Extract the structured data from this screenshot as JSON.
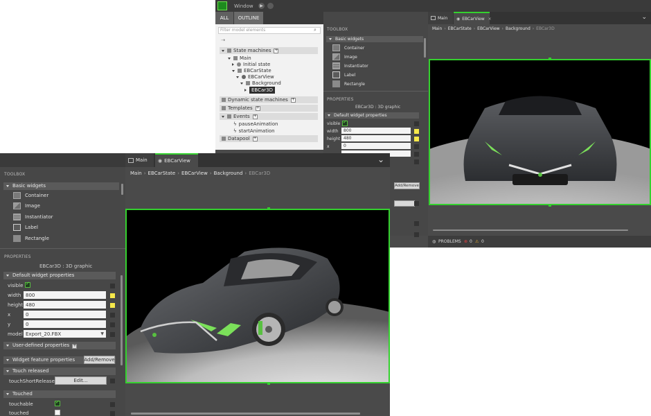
{
  "back": {
    "window_title": "Window",
    "left_tabs": [
      "ALL",
      "OUTLINE"
    ],
    "filter_placeholder": "Filter model elements",
    "tree": [
      {
        "label": "State machines",
        "plus": true
      },
      {
        "label": "Main"
      },
      {
        "label": "Initial state"
      },
      {
        "label": "EBCarState"
      },
      {
        "label": "EBCarView"
      },
      {
        "label": "Background"
      },
      {
        "label": "EBCar3D"
      },
      {
        "label": "Dynamic state machines",
        "plus": true
      },
      {
        "label": "Templates",
        "plus": true
      },
      {
        "label": "Events",
        "plus": true
      },
      {
        "label": "pauseAnimation"
      },
      {
        "label": "startAnimation"
      },
      {
        "label": "Datapool",
        "plus": true
      }
    ],
    "toolbox_title": "TOOLBOX",
    "basic_widgets": "Basic widgets",
    "widgets": [
      "Container",
      "Image",
      "Instantiator",
      "Label",
      "Rectangle"
    ],
    "properties_title": "PROPERTIES",
    "prop_subtitle": "EBCar3D : 3D graphic",
    "default_props": "Default widget properties",
    "props": [
      {
        "label": "visible",
        "value": ""
      },
      {
        "label": "width",
        "value": "800"
      },
      {
        "label": "height",
        "value": "480"
      },
      {
        "label": "x",
        "value": "0"
      }
    ],
    "add_remove": "Add/Remove",
    "tabs": [
      {
        "label": "Main"
      },
      {
        "label": "EBCarView"
      }
    ],
    "breadcrumb": [
      "Main",
      "EBCarState",
      "EBCarView",
      "Background"
    ],
    "breadcrumb_current": "EBCar3D",
    "status_problems": "PROBLEMS",
    "status_errors": "0",
    "status_warnings": "0"
  },
  "front": {
    "toolbox_title": "TOOLBOX",
    "basic_widgets": "Basic widgets",
    "widgets": [
      "Container",
      "Image",
      "Instantiator",
      "Label",
      "Rectangle"
    ],
    "properties_title": "PROPERTIES",
    "prop_subtitle": "EBCar3D : 3D graphic",
    "default_props": "Default widget properties",
    "props": [
      {
        "label": "visible",
        "value": ""
      },
      {
        "label": "width",
        "value": "800"
      },
      {
        "label": "height",
        "value": "480"
      },
      {
        "label": "x",
        "value": "0"
      },
      {
        "label": "y",
        "value": "0"
      },
      {
        "label": "model",
        "value": "Export_20.FBX"
      }
    ],
    "user_defined": "User-defined properties",
    "widget_feature": "Widget feature properties",
    "add_remove": "Add/Remove",
    "touch_released": "Touch released",
    "touch_short_released": "touchShortReleased",
    "edit_button": "Edit...",
    "touched_section": "Touched",
    "touchable": "touchable",
    "touched": "touched",
    "tabs": [
      {
        "label": "Main"
      },
      {
        "label": "EBCarView"
      }
    ],
    "breadcrumb": [
      "Main",
      "EBCarState",
      "EBCarView",
      "Background"
    ],
    "breadcrumb_current": "EBCar3D"
  },
  "colors": {
    "accent": "#34d12e",
    "bg_dark": "#2f2f2f",
    "panel": "#474747",
    "yellow": "#f6e84a"
  }
}
